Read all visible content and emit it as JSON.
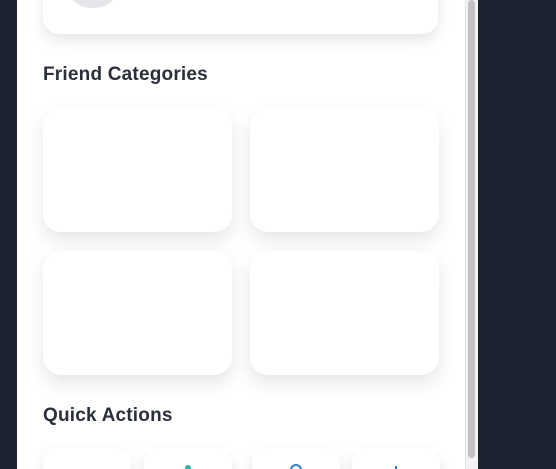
{
  "sections": {
    "friend_categories_title": "Friend Categories",
    "quick_actions_title": "Quick Actions"
  },
  "colors": {
    "background": "#1c2230",
    "panel": "#ffffff",
    "title_text": "#2a2f3a",
    "teal_icon": "#2bb3a3",
    "blue_icon": "#2a7fd4"
  },
  "quick_actions": [
    {
      "icon": "action-icon"
    },
    {
      "icon": "user-icon"
    },
    {
      "icon": "chat-icon"
    },
    {
      "icon": "plus-icon"
    }
  ]
}
